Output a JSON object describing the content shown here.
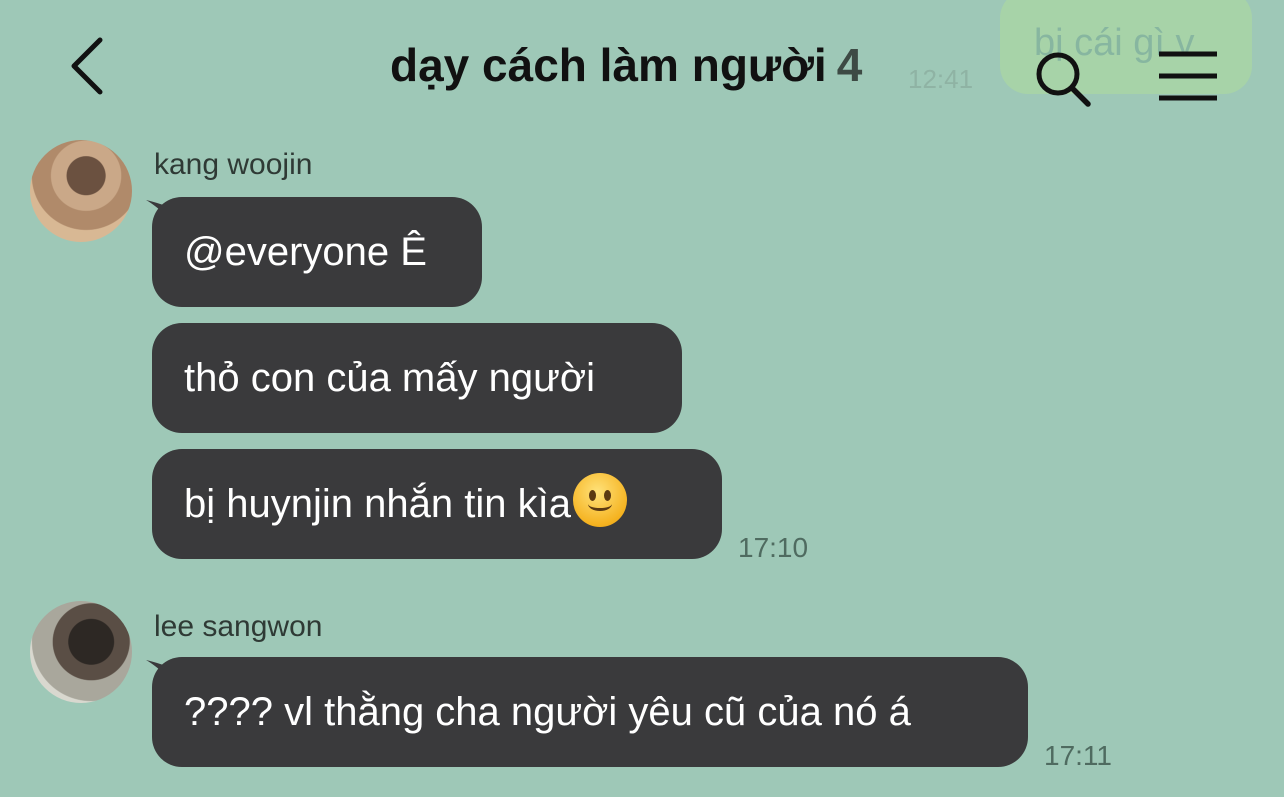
{
  "header": {
    "title": "dạy cách làm người",
    "member_count": "4"
  },
  "background_peek": {
    "message": "bị cái gì v",
    "time": "12:41"
  },
  "messages": [
    {
      "sender": "kang woojin",
      "avatar_icon": "avatar",
      "bubbles": [
        "@everyone Ê",
        "thỏ con của mấy người",
        "bị huynjin nhắn tin kìa"
      ],
      "emoji": "slightly-smiling-face",
      "time": "17:10"
    },
    {
      "sender": "lee sangwon",
      "avatar_icon": "avatar",
      "bubbles": [
        "???? vl thằng cha người yêu cũ của nó á"
      ],
      "time": "17:11"
    }
  ],
  "colors": {
    "background": "#9ec8b7",
    "bubble": "#3a3a3c",
    "bubble_text": "#ffffff",
    "title": "#111111"
  }
}
